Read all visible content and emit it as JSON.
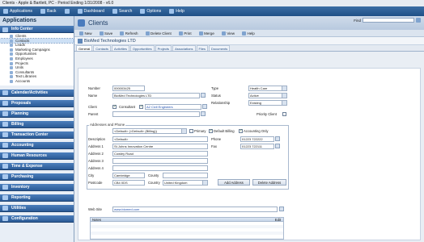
{
  "window": {
    "title": "Clients - Apple & Bartlett, PC - Period Ending 1/31/2008 - v6.0"
  },
  "menubar": {
    "items": [
      "Applications",
      "Back",
      "",
      "Dashboard",
      "Search",
      "Options",
      "Help"
    ]
  },
  "sidebar": {
    "title": "Applications",
    "info_center": {
      "label": "Info Center",
      "items": [
        "Clients",
        "Contacts",
        "Leads",
        "Marketing Campaigns",
        "Opportunities",
        "Employees",
        "Projects",
        "Units",
        "Consultants",
        "Text Libraries",
        "Accounts"
      ],
      "selected_index": 1
    },
    "sections": [
      "Calendar/Activities",
      "Proposals",
      "Planning",
      "Billing",
      "Transaction Center",
      "Accounting",
      "Human Resources",
      "Time & Expense",
      "Purchasing",
      "Inventory",
      "Reporting",
      "Utilities",
      "Configuration"
    ]
  },
  "header": {
    "title": "Clients",
    "find_label": "Find"
  },
  "toolbar": {
    "items": [
      "New",
      "Save",
      "Refresh",
      "Delete Client",
      "Print",
      "Merge",
      "View",
      "Help"
    ]
  },
  "record": {
    "name": "BioMed Technologies LTD"
  },
  "tabs": [
    "General",
    "Contacts",
    "Activities",
    "Opportunities",
    "Projects",
    "Associations",
    "Files",
    "Documents"
  ],
  "active_tab": 0,
  "form": {
    "number_label": "Number",
    "number": "000003425",
    "name_label": "Name",
    "name": "BioMed Technologies LTD",
    "client_label": "Client",
    "client_checked": true,
    "consultant_label": "Consultant",
    "consultant_checked": true,
    "a2_link": "A2 Civil Engineers",
    "parent_label": "Parent",
    "parent": "",
    "type_label": "Type",
    "type": "Health Care",
    "status_label": "Status",
    "status": "Active",
    "relationship_label": "Relationship",
    "relationship": "Existing",
    "priority_label": "Priority Client"
  },
  "address": {
    "group_label": "Addresses and Phone",
    "selector": "<Default> (<Default> (Billing))",
    "primary_label": "Primary",
    "default_billing_label": "Default Billing",
    "accounting_only_label": "Accounting Only",
    "description_label": "Description",
    "description": "<Default>",
    "address1_label": "Address 1",
    "address1": "St.Johns Innovation Centre",
    "address2_label": "Address 2",
    "address2": "Cowley Road",
    "address3_label": "Address 3",
    "address3": "",
    "address4_label": "Address 4",
    "address4": "",
    "city_label": "City",
    "city": "Cambridge",
    "county_label": "County",
    "county": "",
    "postcode_label": "Postcode",
    "postcode": "CB4 0DS",
    "country_label": "Country",
    "country": "United Kingdom",
    "phone_label": "Phone",
    "phone": "01223 722222",
    "fax_label": "Fax",
    "fax": "01223 722111",
    "add_button": "Add Address",
    "delete_button": "Delete Address"
  },
  "web": {
    "label": "Web Site",
    "value": "www.biomed.com"
  },
  "notes": {
    "label": "Notes",
    "edit_label": "Edit"
  },
  "colors": {
    "menubar": "#2b5b97",
    "sidebar_section": "#3a6ea9",
    "link": "#1f4fb0"
  }
}
